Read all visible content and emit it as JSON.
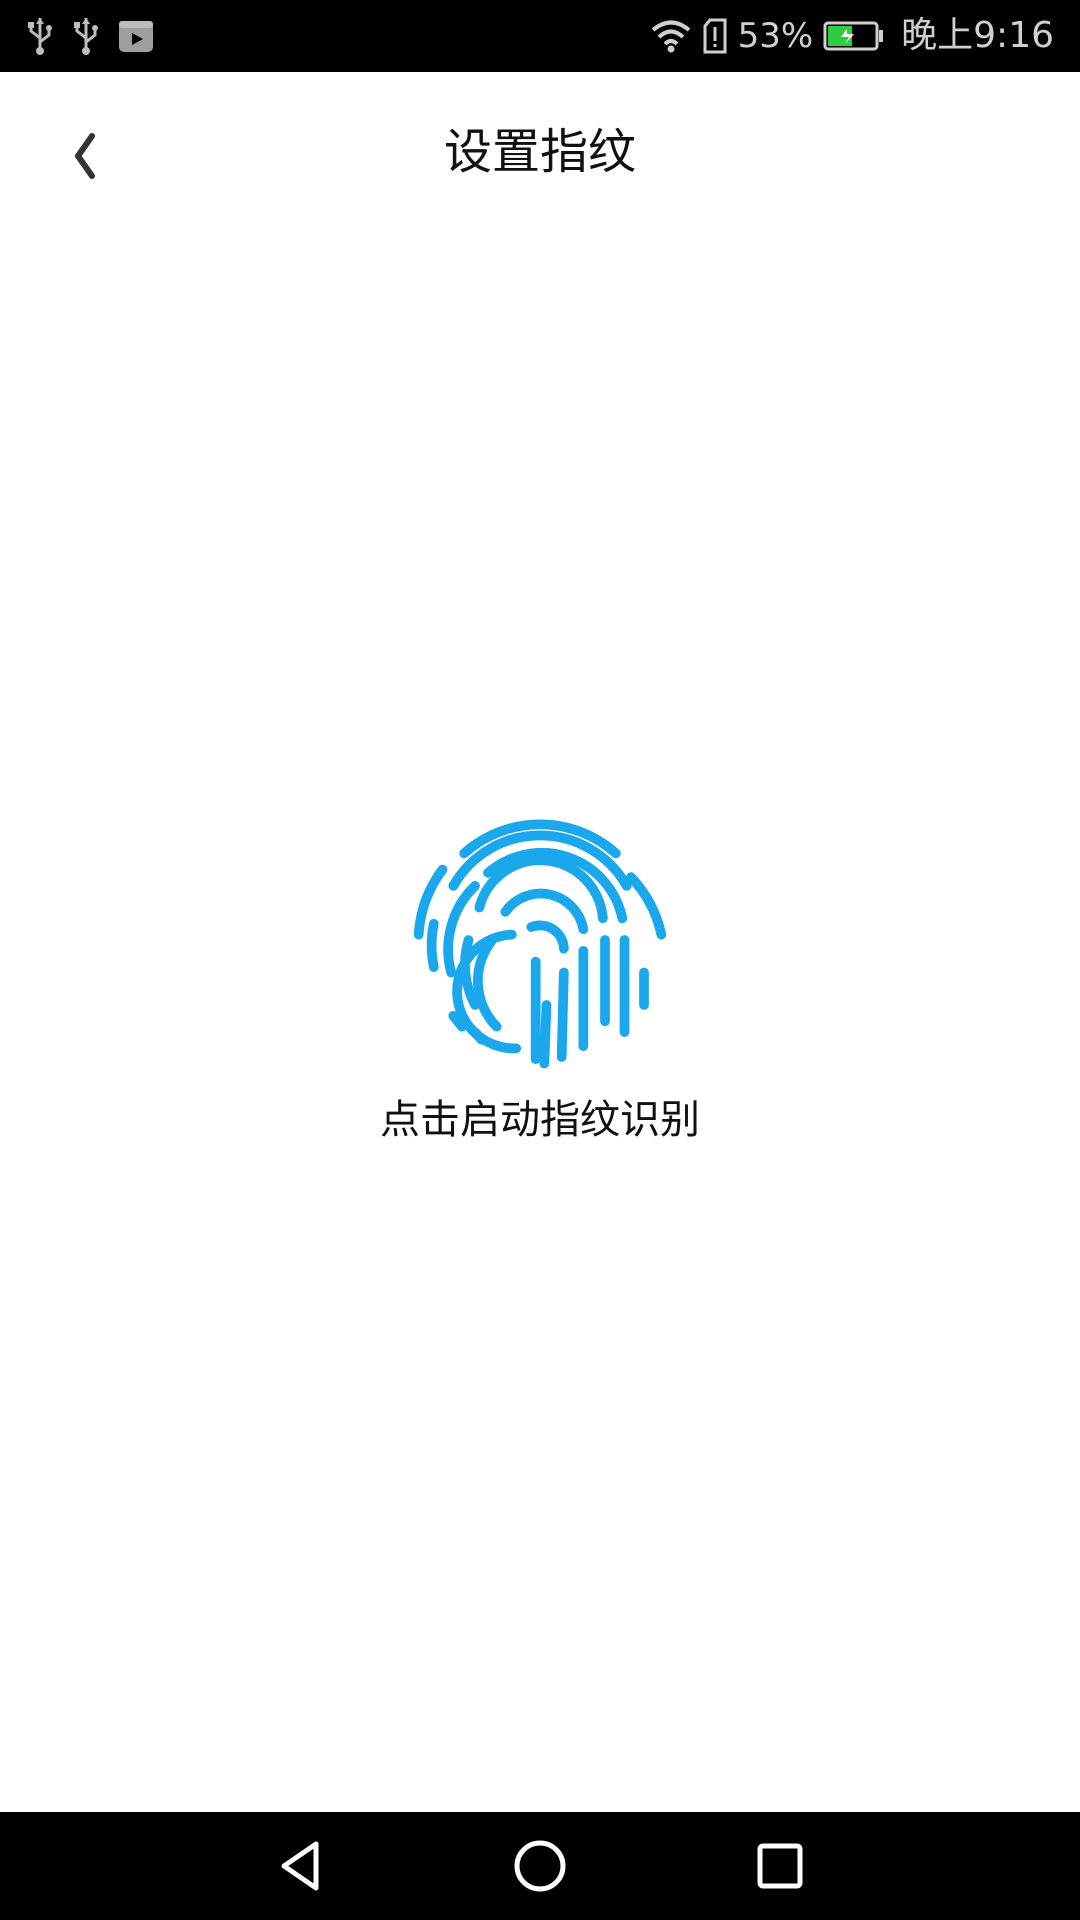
{
  "status_bar": {
    "left_icons": [
      "usb-icon",
      "usb-icon",
      "video-icon"
    ],
    "battery_percent_text": "53%",
    "battery_level": 0.53,
    "time": "晚上9:16",
    "icons": [
      "wifi-icon",
      "sim-alert-icon",
      "battery-charging-icon"
    ]
  },
  "header": {
    "title": "设置指纹",
    "back_icon": "chevron-left-icon"
  },
  "main": {
    "fingerprint_icon": "fingerprint-icon",
    "caption": "点击启动指纹识别",
    "accent_color": "#1aa7ec"
  },
  "nav_bar": {
    "buttons": [
      "back-triangle-icon",
      "home-circle-icon",
      "recents-square-icon"
    ]
  }
}
